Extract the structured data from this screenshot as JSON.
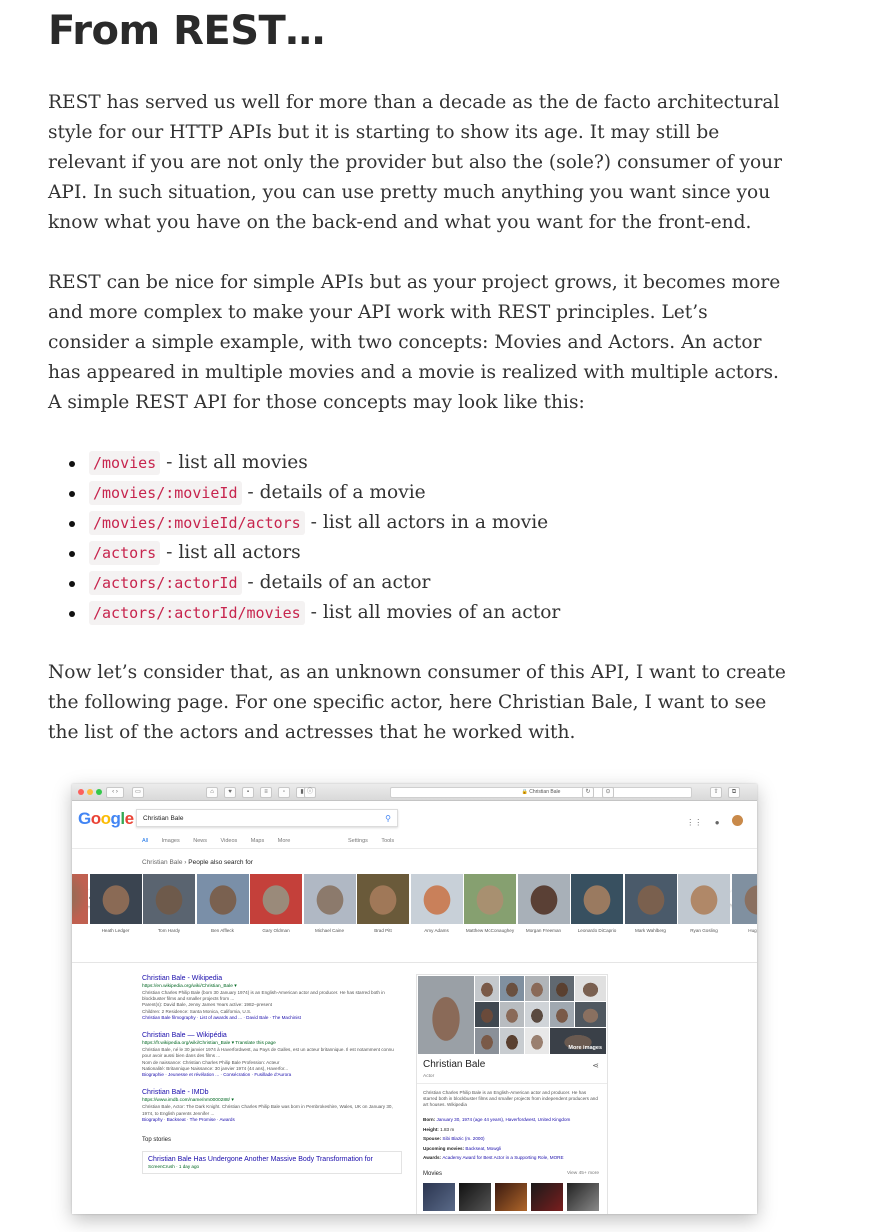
{
  "heading": "From REST…",
  "paragraphs": {
    "p1": "REST has served us well for more than a decade as the de facto architectural style for our HTTP APIs but it is starting to show its age. It may still be relevant if you are not only the provider but also the (sole?) consumer of your API. In such situation, you can use pretty much anything you want since you know what you have on the back-end and what you want for the front-end.",
    "p2": "REST can be nice for simple APIs but as your project grows, it becomes more and more complex to make your API work with REST principles. Let’s consider a simple example, with two concepts: Movies and Actors. An actor has appeared in multiple movies and a movie is realized with multiple actors. A simple REST API for those concepts may look like this:",
    "p3": "Now let’s consider that, as an unknown consumer of this API, I want to create the following page. For one specific actor, here Christian Bale, I want to see the list of the actors and actresses that he worked with."
  },
  "routes": [
    {
      "path": "/movies",
      "desc": " - list all movies"
    },
    {
      "path": "/movies/:movieId",
      "desc": " - details of a movie"
    },
    {
      "path": "/movies/:movieId/actors",
      "desc": " - list all actors in a movie"
    },
    {
      "path": "/actors",
      "desc": " - list all actors"
    },
    {
      "path": "/actors/:actorId",
      "desc": " - details of an actor"
    },
    {
      "path": "/actors/:actorId/movies",
      "desc": " - list all movies of an actor"
    }
  ],
  "screenshot": {
    "url": "🔒 Christian Bale",
    "logo": "Google",
    "logo_colors": [
      "#4285f4",
      "#ea4335",
      "#fbbc05",
      "#4285f4",
      "#34a853",
      "#ea4335"
    ],
    "search_query": "Christian Bale",
    "tabs": [
      "All",
      "Images",
      "News",
      "Videos",
      "Maps",
      "More"
    ],
    "tools": [
      "Settings",
      "Tools"
    ],
    "breadcrumb_prefix": "Christian Bale › ",
    "breadcrumb_current": "People also search for",
    "people": [
      "Heath Ledger",
      "Tom Hardy",
      "Ben Affleck",
      "Gary Oldman",
      "Michael Caine",
      "Brad Pitt",
      "Amy Adams",
      "Matthew McConaughey",
      "Morgan Freeman",
      "Leonardo DiCaprio",
      "Mark Wahlberg",
      "Ryan Gosling",
      "Hugh J..."
    ],
    "results": [
      {
        "title": "Christian Bale - Wikipedia",
        "url": "https://en.wikipedia.org/wiki/Christian_Bale ▾",
        "snippet": "Christian Charles Philip Bale (born 30 January 1974) is an English-American actor and producer. He has starred both in blockbuster films and smaller projects from ...",
        "facts1": "Parent(s): David Bale, Jenny James   Years active: 1982–present",
        "facts2": "Children: 2   Residence: Santa Monica, California, U.S.",
        "links": "Christian Bale filmography · List of awards and ... · David Bale · The Machinist"
      },
      {
        "title": "Christian Bale — Wikipédia",
        "url": "https://fr.wikipedia.org/wiki/Christian_Bale ▾ Translate this page",
        "snippet": "Christian Bale, né le 30 janvier 1974 à Haverfordwest, au Pays de Galles, est un acteur britannique. Il est notamment connu pour avoir aussi bien dans des films ...",
        "facts1": "Nom de naissance: Christian Charles Philip Bale   Profession: Acteur",
        "facts2": "Nationalité: Britannique   Naissance: 30 janvier 1974 (44 ans), Haverfor...",
        "links": "Biographie · Jeunesse et révélation ... · Consécration · Fusillade d'Aurora"
      },
      {
        "title": "Christian Bale - IMDb",
        "url": "https://www.imdb.com/name/nm0000288/ ▾",
        "snippet": "Christian Bale, Actor: The Dark Knight. Christian Charles Philip Bale was born in Pembrokeshire, Wales, UK on January 30, 1974, to English parents Jennifer ...",
        "facts1": "",
        "facts2": "",
        "links": "Biography · Backseat · The Promise · Awards"
      }
    ],
    "top_stories": "Top stories",
    "story_title": "Christian Bale Has Undergone Another Massive Body Transformation for",
    "story_source": "ScreenCrush · 1 day ago",
    "panel": {
      "name": "Christian Bale",
      "role": "Actor",
      "more_images": "More images",
      "description": "Christian Charles Philip Bale is an English-American actor and producer. He has starred both in blockbuster films and smaller projects from independent producers and art houses. Wikipedia",
      "born_label": "Born: ",
      "born_value": "January 30, 1974 (age 44 years), Haverfordwest, United Kingdom",
      "height_label": "Height: ",
      "height_value": "1.83 m",
      "spouse_label": "Spouse: ",
      "spouse_value": "Sibi Blazic (m. 2000)",
      "upcoming_label": "Upcoming movies: ",
      "upcoming_value": "Backseat, Mowgli",
      "awards_label": "Awards: ",
      "awards_value": "Academy Award for Best Actor in a Supporting Role, MORE",
      "movies_label": "Movies",
      "view_more": "View 45+ more"
    }
  }
}
